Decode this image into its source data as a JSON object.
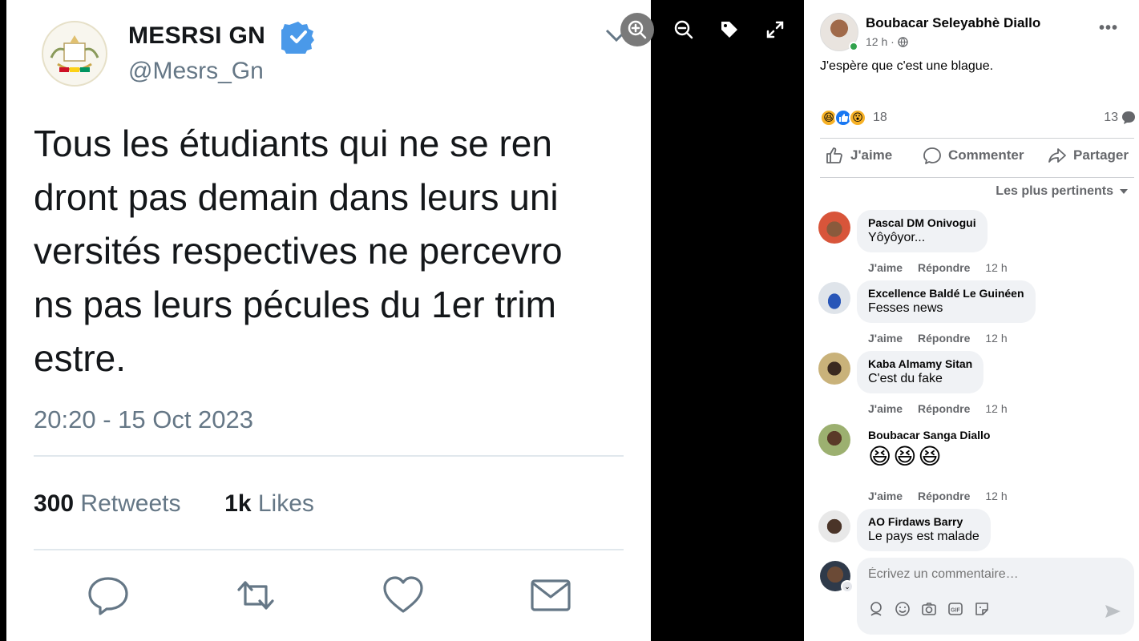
{
  "tweet": {
    "account_name": "MESRSI GN",
    "handle": "@Mesrs_Gn",
    "body_lines": [
      "Tous les étudiants qui ne se ren",
      "dront pas demain dans leurs uni",
      "versités respectives ne percevro",
      "ns pas leurs pécules du 1er trim",
      "estre."
    ],
    "timestamp": "20:20 - 15 Oct 2023",
    "retweets_count": "300",
    "retweets_label": "Retweets",
    "likes_count": "1k",
    "likes_label": "Likes",
    "icons": [
      "reply-icon",
      "retweet-icon",
      "like-heart-icon",
      "dm-mail-icon"
    ]
  },
  "viewer_tools": [
    "zoom-in-icon",
    "zoom-out-icon",
    "tag-icon",
    "fullscreen-icon"
  ],
  "post": {
    "author": "Boubacar Seleyabhè Diallo",
    "time": "12 h ·",
    "text": "J'espère que c'est une blague.",
    "reaction_count": "18",
    "comment_count": "13",
    "actions": {
      "like": "J'aime",
      "comment": "Commenter",
      "share": "Partager"
    },
    "sort_label": "Les plus pertinents"
  },
  "comments": [
    {
      "name": "Pascal DM Onivogui",
      "text": "Yôyôyor...",
      "like": "J'aime",
      "reply": "Répondre",
      "time": "12 h"
    },
    {
      "name": "Excellence Baldé Le Guinéen",
      "text": "Fesses news",
      "like": "J'aime",
      "reply": "Répondre",
      "time": "12 h"
    },
    {
      "name": "Kaba Almamy Sitan",
      "text": "C'est du fake",
      "like": "J'aime",
      "reply": "Répondre",
      "time": "12 h"
    },
    {
      "name": "Boubacar Sanga Diallo",
      "text": "😆😆😆",
      "like": "J'aime",
      "reply": "Répondre",
      "time": "12 h"
    },
    {
      "name": "AO Firdaws Barry",
      "text": "Le pays est malade"
    }
  ],
  "composer": {
    "placeholder": "Écrivez un commentaire…",
    "tools": [
      "avatar-sticker-icon",
      "emoji-icon",
      "camera-icon",
      "gif-icon",
      "sticker-icon"
    ]
  },
  "colors": {
    "fb_blue": "#1877f2",
    "twitter_blue": "#1da1f2",
    "gray_text": "#65676b"
  }
}
